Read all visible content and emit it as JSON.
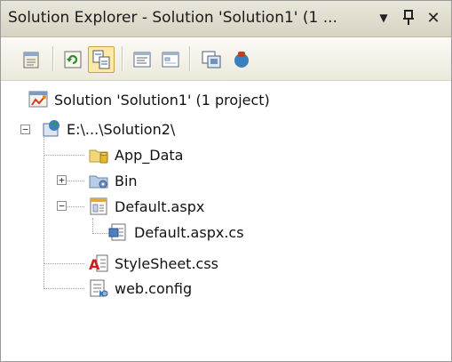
{
  "window": {
    "title": "Solution Explorer - Solution 'Solution1' (1 ...",
    "dropdown_glyph": "▼",
    "pin_glyph": "Ⴔ",
    "close_glyph": "✕"
  },
  "toolbar": {
    "buttons": [
      {
        "icon": "properties-icon"
      },
      {
        "icon": "refresh-icon"
      },
      {
        "icon": "nest-related-files-icon",
        "active": true
      },
      {
        "icon": "view-code-icon"
      },
      {
        "icon": "view-designer-icon"
      },
      {
        "icon": "copy-web-site-icon"
      },
      {
        "icon": "asp-net-configuration-icon"
      }
    ]
  },
  "tree": {
    "solution": {
      "label": "Solution 'Solution1' (1 project)"
    },
    "project": {
      "label": "E:\\...\\Solution2\\",
      "expander": "−"
    },
    "items": [
      {
        "label": "App_Data",
        "icon": "folder-app-data-icon"
      },
      {
        "label": "Bin",
        "icon": "folder-bin-icon",
        "expander": "+"
      },
      {
        "label": "Default.aspx",
        "icon": "aspx-page-icon",
        "expander": "−"
      },
      {
        "label": "Default.aspx.cs",
        "icon": "cs-code-file-icon"
      },
      {
        "label": "StyleSheet.css",
        "icon": "css-file-icon"
      },
      {
        "label": "web.config",
        "icon": "config-file-icon"
      }
    ]
  }
}
